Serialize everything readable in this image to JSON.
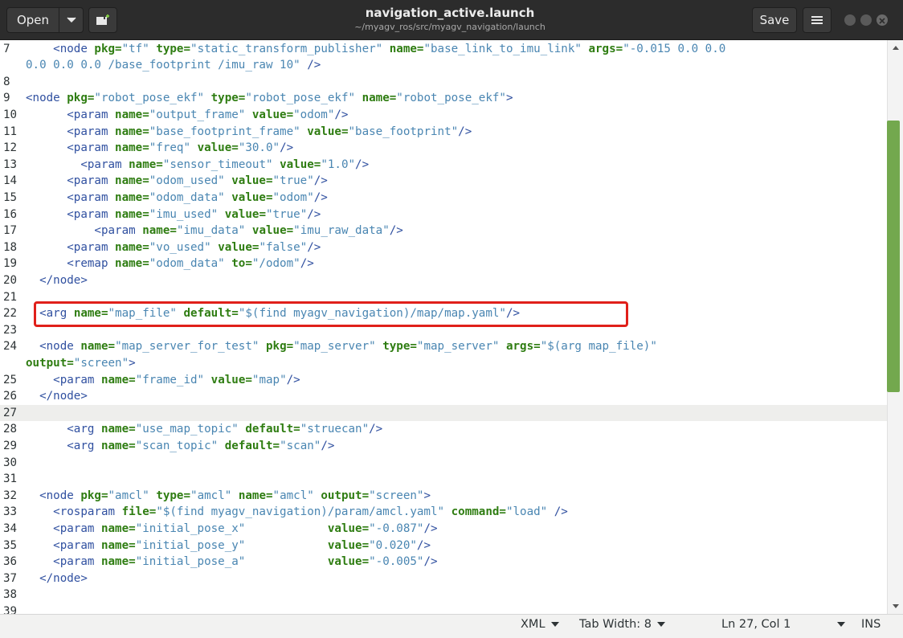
{
  "header": {
    "open_label": "Open",
    "title": "navigation_active.launch",
    "subtitle": "~/myagv_ros/src/myagv_navigation/launch",
    "save_label": "Save"
  },
  "editor": {
    "current_line": "27",
    "highlighted_line": "22",
    "lines": [
      {
        "n": "7",
        "y": 0,
        "indent": "    ",
        "segs": [
          [
            "tag",
            "<node "
          ],
          [
            "attr",
            "pkg="
          ],
          [
            "val",
            "\"tf\" "
          ],
          [
            "attr",
            "type="
          ],
          [
            "val",
            "\"static_transform_publisher\" "
          ],
          [
            "attr",
            "name="
          ],
          [
            "val",
            "\"base_link_to_imu_link\" "
          ],
          [
            "attr",
            "args="
          ],
          [
            "val",
            "\"-0.015 0.0 0.0"
          ]
        ]
      },
      {
        "n": "",
        "y": 1,
        "indent": "",
        "segs": [
          [
            "val",
            "0.0 0.0 0.0 /base_footprint /imu_raw 10\" "
          ],
          [
            "tag",
            "/>"
          ]
        ]
      },
      {
        "n": "8",
        "y": 2,
        "indent": "",
        "segs": []
      },
      {
        "n": "9",
        "y": 3,
        "indent": "",
        "segs": [
          [
            "tag",
            "<node "
          ],
          [
            "attr",
            "pkg="
          ],
          [
            "val",
            "\"robot_pose_ekf\" "
          ],
          [
            "attr",
            "type="
          ],
          [
            "val",
            "\"robot_pose_ekf\" "
          ],
          [
            "attr",
            "name="
          ],
          [
            "val",
            "\"robot_pose_ekf\""
          ],
          [
            "tag",
            ">"
          ]
        ]
      },
      {
        "n": "10",
        "y": 4,
        "indent": "      ",
        "segs": [
          [
            "tag",
            "<param "
          ],
          [
            "attr",
            "name="
          ],
          [
            "val",
            "\"output_frame\" "
          ],
          [
            "attr",
            "value="
          ],
          [
            "val",
            "\"odom\""
          ],
          [
            "tag",
            "/>"
          ]
        ]
      },
      {
        "n": "11",
        "y": 5,
        "indent": "      ",
        "segs": [
          [
            "tag",
            "<param "
          ],
          [
            "attr",
            "name="
          ],
          [
            "val",
            "\"base_footprint_frame\" "
          ],
          [
            "attr",
            "value="
          ],
          [
            "val",
            "\"base_footprint\""
          ],
          [
            "tag",
            "/>"
          ]
        ]
      },
      {
        "n": "12",
        "y": 6,
        "indent": "      ",
        "segs": [
          [
            "tag",
            "<param "
          ],
          [
            "attr",
            "name="
          ],
          [
            "val",
            "\"freq\" "
          ],
          [
            "attr",
            "value="
          ],
          [
            "val",
            "\"30.0\""
          ],
          [
            "tag",
            "/>"
          ]
        ]
      },
      {
        "n": "13",
        "y": 7,
        "indent": "        ",
        "segs": [
          [
            "tag",
            "<param "
          ],
          [
            "attr",
            "name="
          ],
          [
            "val",
            "\"sensor_timeout\" "
          ],
          [
            "attr",
            "value="
          ],
          [
            "val",
            "\"1.0\""
          ],
          [
            "tag",
            "/>"
          ]
        ]
      },
      {
        "n": "14",
        "y": 8,
        "indent": "      ",
        "segs": [
          [
            "tag",
            "<param "
          ],
          [
            "attr",
            "name="
          ],
          [
            "val",
            "\"odom_used\" "
          ],
          [
            "attr",
            "value="
          ],
          [
            "val",
            "\"true\""
          ],
          [
            "tag",
            "/>"
          ]
        ]
      },
      {
        "n": "15",
        "y": 9,
        "indent": "      ",
        "segs": [
          [
            "tag",
            "<param "
          ],
          [
            "attr",
            "name="
          ],
          [
            "val",
            "\"odom_data\" "
          ],
          [
            "attr",
            "value="
          ],
          [
            "val",
            "\"odom\""
          ],
          [
            "tag",
            "/>"
          ]
        ]
      },
      {
        "n": "16",
        "y": 10,
        "indent": "      ",
        "segs": [
          [
            "tag",
            "<param "
          ],
          [
            "attr",
            "name="
          ],
          [
            "val",
            "\"imu_used\" "
          ],
          [
            "attr",
            "value="
          ],
          [
            "val",
            "\"true\""
          ],
          [
            "tag",
            "/>"
          ]
        ]
      },
      {
        "n": "17",
        "y": 11,
        "indent": "          ",
        "segs": [
          [
            "tag",
            "<param "
          ],
          [
            "attr",
            "name="
          ],
          [
            "val",
            "\"imu_data\" "
          ],
          [
            "attr",
            "value="
          ],
          [
            "val",
            "\"imu_raw_data\""
          ],
          [
            "tag",
            "/>"
          ]
        ]
      },
      {
        "n": "18",
        "y": 12,
        "indent": "      ",
        "segs": [
          [
            "tag",
            "<param "
          ],
          [
            "attr",
            "name="
          ],
          [
            "val",
            "\"vo_used\" "
          ],
          [
            "attr",
            "value="
          ],
          [
            "val",
            "\"false\""
          ],
          [
            "tag",
            "/>"
          ]
        ]
      },
      {
        "n": "19",
        "y": 13,
        "indent": "      ",
        "segs": [
          [
            "tag",
            "<remap "
          ],
          [
            "attr",
            "name="
          ],
          [
            "val",
            "\"odom_data\" "
          ],
          [
            "attr",
            "to="
          ],
          [
            "val",
            "\"/odom\""
          ],
          [
            "tag",
            "/>"
          ]
        ]
      },
      {
        "n": "20",
        "y": 14,
        "indent": "  ",
        "segs": [
          [
            "tag",
            "</node>"
          ]
        ]
      },
      {
        "n": "21",
        "y": 15,
        "indent": "",
        "segs": []
      },
      {
        "n": "22",
        "y": 16,
        "indent": "  ",
        "segs": [
          [
            "tag",
            "<arg "
          ],
          [
            "attr",
            "name="
          ],
          [
            "val",
            "\"map_file\" "
          ],
          [
            "attr",
            "default="
          ],
          [
            "val",
            "\"$(find myagv_navigation)/map/map.yaml\""
          ],
          [
            "tag",
            "/>"
          ]
        ]
      },
      {
        "n": "23",
        "y": 17,
        "indent": "",
        "segs": []
      },
      {
        "n": "24",
        "y": 18,
        "indent": "  ",
        "segs": [
          [
            "tag",
            "<node "
          ],
          [
            "attr",
            "name="
          ],
          [
            "val",
            "\"map_server_for_test\" "
          ],
          [
            "attr",
            "pkg="
          ],
          [
            "val",
            "\"map_server\" "
          ],
          [
            "attr",
            "type="
          ],
          [
            "val",
            "\"map_server\" "
          ],
          [
            "attr",
            "args="
          ],
          [
            "val",
            "\"$(arg map_file)\""
          ]
        ]
      },
      {
        "n": "",
        "y": 19,
        "indent": "",
        "segs": [
          [
            "attr",
            "output="
          ],
          [
            "val",
            "\"screen\""
          ],
          [
            "tag",
            ">"
          ]
        ]
      },
      {
        "n": "25",
        "y": 20,
        "indent": "    ",
        "segs": [
          [
            "tag",
            "<param "
          ],
          [
            "attr",
            "name="
          ],
          [
            "val",
            "\"frame_id\" "
          ],
          [
            "attr",
            "value="
          ],
          [
            "val",
            "\"map\""
          ],
          [
            "tag",
            "/>"
          ]
        ]
      },
      {
        "n": "26",
        "y": 21,
        "indent": "  ",
        "segs": [
          [
            "tag",
            "</node>"
          ]
        ]
      },
      {
        "n": "27",
        "y": 22,
        "indent": "",
        "segs": []
      },
      {
        "n": "28",
        "y": 23,
        "indent": "      ",
        "segs": [
          [
            "tag",
            "<arg "
          ],
          [
            "attr",
            "name="
          ],
          [
            "val",
            "\"use_map_topic\" "
          ],
          [
            "attr",
            "default="
          ],
          [
            "val",
            "\"struecan\""
          ],
          [
            "tag",
            "/>"
          ]
        ]
      },
      {
        "n": "29",
        "y": 24,
        "indent": "      ",
        "segs": [
          [
            "tag",
            "<arg "
          ],
          [
            "attr",
            "name="
          ],
          [
            "val",
            "\"scan_topic\" "
          ],
          [
            "attr",
            "default="
          ],
          [
            "val",
            "\"scan\""
          ],
          [
            "tag",
            "/>"
          ]
        ]
      },
      {
        "n": "30",
        "y": 25,
        "indent": "",
        "segs": []
      },
      {
        "n": "31",
        "y": 26,
        "indent": "",
        "segs": []
      },
      {
        "n": "32",
        "y": 27,
        "indent": "  ",
        "segs": [
          [
            "tag",
            "<node "
          ],
          [
            "attr",
            "pkg="
          ],
          [
            "val",
            "\"amcl\" "
          ],
          [
            "attr",
            "type="
          ],
          [
            "val",
            "\"amcl\" "
          ],
          [
            "attr",
            "name="
          ],
          [
            "val",
            "\"amcl\" "
          ],
          [
            "attr",
            "output="
          ],
          [
            "val",
            "\"screen\""
          ],
          [
            "tag",
            ">"
          ]
        ]
      },
      {
        "n": "33",
        "y": 28,
        "indent": "    ",
        "segs": [
          [
            "tag",
            "<rosparam "
          ],
          [
            "attr",
            "file="
          ],
          [
            "val",
            "\"$(find myagv_navigation)/param/amcl.yaml\" "
          ],
          [
            "attr",
            "command="
          ],
          [
            "val",
            "\"load\" "
          ],
          [
            "tag",
            "/>"
          ]
        ]
      },
      {
        "n": "34",
        "y": 29,
        "indent": "    ",
        "segs": [
          [
            "tag",
            "<param "
          ],
          [
            "attr",
            "name="
          ],
          [
            "val",
            "\"initial_pose_x\"            "
          ],
          [
            "attr",
            "value="
          ],
          [
            "val",
            "\"-0.087\""
          ],
          [
            "tag",
            "/>"
          ]
        ]
      },
      {
        "n": "35",
        "y": 30,
        "indent": "    ",
        "segs": [
          [
            "tag",
            "<param "
          ],
          [
            "attr",
            "name="
          ],
          [
            "val",
            "\"initial_pose_y\"            "
          ],
          [
            "attr",
            "value="
          ],
          [
            "val",
            "\"0.020\""
          ],
          [
            "tag",
            "/>"
          ]
        ]
      },
      {
        "n": "36",
        "y": 31,
        "indent": "    ",
        "segs": [
          [
            "tag",
            "<param "
          ],
          [
            "attr",
            "name="
          ],
          [
            "val",
            "\"initial_pose_a\"            "
          ],
          [
            "attr",
            "value="
          ],
          [
            "val",
            "\"-0.005\""
          ],
          [
            "tag",
            "/>"
          ]
        ]
      },
      {
        "n": "37",
        "y": 32,
        "indent": "  ",
        "segs": [
          [
            "tag",
            "</node>"
          ]
        ]
      },
      {
        "n": "38",
        "y": 33,
        "indent": "",
        "segs": []
      },
      {
        "n": "39",
        "y": 34,
        "indent": "",
        "segs": []
      }
    ]
  },
  "statusbar": {
    "language": "XML",
    "tab_width": "Tab Width: 8",
    "position": "Ln 27, Col 1",
    "mode": "INS"
  },
  "colors": {
    "tag": "#3050a0",
    "attribute": "#2f7d12",
    "value": "#4a86b2",
    "highlight_border": "#e0201a",
    "scroll_thumb": "#73a84e"
  },
  "icons": [
    "chevron-down-icon",
    "new-document-icon",
    "hamburger-menu-icon",
    "window-minimize-icon",
    "window-maximize-icon",
    "window-close-icon",
    "scroll-up-icon",
    "scroll-down-icon"
  ]
}
